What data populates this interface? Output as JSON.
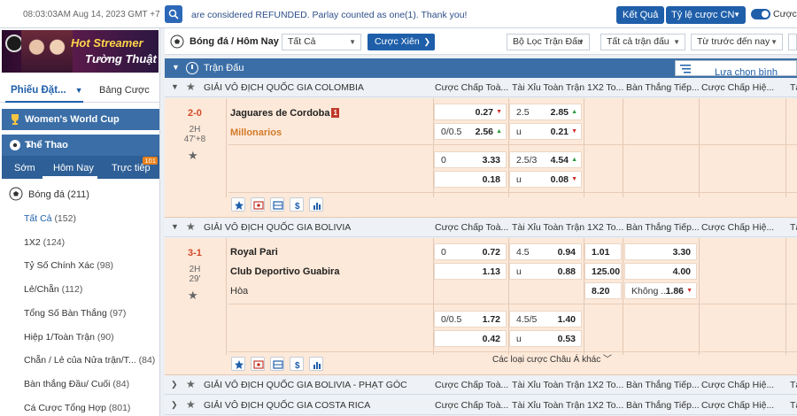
{
  "topbar": {
    "clock": "08:03:03AM Aug 14, 2023 GMT +7",
    "marquee": "are considered REFUNDED. Parlay counted as one(1). Thank you!",
    "results": "Kết Quả",
    "odds_type": "Tỷ lệ cược CN",
    "toggle_label": "Cược"
  },
  "sidebar": {
    "banner_line1": "Hot Streamer",
    "banner_line2": "Tường Thuật",
    "tab_bets": "Phiếu Đặt...",
    "tab_parlay": "Bảng Cược",
    "womens_world_cup": "Women's World Cup",
    "sports": "Thể Thao",
    "subtabs": [
      "Sớm",
      "Hôm Nay",
      "Trực tiếp"
    ],
    "live_count": "101",
    "soccer": "Bóng đá (211)",
    "markets": [
      {
        "label": "Tất Cả",
        "count": "(152)",
        "active": true
      },
      {
        "label": "1X2",
        "count": "(124)"
      },
      {
        "label": "Tỷ Số Chính Xác",
        "count": "(98)"
      },
      {
        "label": "Lẻ/Chẵn",
        "count": "(112)"
      },
      {
        "label": "Tổng Số Bàn Thắng",
        "count": "(97)"
      },
      {
        "label": "Hiệp 1/Toàn Trận",
        "count": "(90)"
      },
      {
        "label": "Chẵn / Lẻ của Nửa trận/T...",
        "count": "(84)"
      },
      {
        "label": "Bàn thắng Đầu/ Cuối",
        "count": "(84)"
      },
      {
        "label": "Cá Cược Tổng Hợp",
        "count": "(801)"
      }
    ]
  },
  "filterbar": {
    "title": "Bóng đá / Hôm Nay",
    "all": "Tất Cả",
    "parlay": "Cược Xiên",
    "filter": "Bộ Lọc Trận Đấu",
    "all_matches": "Tất cả trận đấu",
    "sort": "Từ trước đến nay"
  },
  "section": {
    "title": "Trận Đấu",
    "select_match": "Lựa chọn bình thường"
  },
  "columns": [
    "Cược Chấp Toà...",
    "Tài Xỉu Toàn Trận",
    "1X2 To...",
    "Bàn Thắng Tiếp...",
    "Cược Chấp Hiệ...",
    "Tài"
  ],
  "leagues": [
    {
      "name": "GIẢI VÔ ĐỊCH QUỐC GIA COLOMBIA"
    },
    {
      "name": "GIẢI VÔ ĐỊCH QUỐC GIA BOLIVIA"
    },
    {
      "name": "GIẢI VÔ ĐỊCH QUỐC GIA BOLIVIA - PHẠT GÓC"
    },
    {
      "name": "GIẢI VÔ ĐỊCH QUỐC GIA COSTA RICA"
    }
  ],
  "match1": {
    "score": "2-0",
    "half": "2H",
    "minute": "47'+8",
    "home": "Jaguares de Cordoba",
    "home_red": "1",
    "away": "Millonarios",
    "l1": {
      "hdp_h": "",
      "hdp_o": "0.27",
      "ou_h": "2.5",
      "ou_o": "2.85"
    },
    "l2": {
      "hdp_h": "0/0.5",
      "hdp_o": "2.56",
      "ou_h": "u",
      "ou_o": "0.21"
    },
    "l3": {
      "hdp_h": "0",
      "hdp_o": "3.33",
      "ou_h": "2.5/3",
      "ou_o": "4.54"
    },
    "l4": {
      "hdp_h": "",
      "hdp_o": "0.18",
      "ou_h": "u",
      "ou_o": "0.08"
    }
  },
  "match2": {
    "score": "3-1",
    "half": "2H",
    "minute": "29'",
    "home": "Royal Pari",
    "away": "Club Deportivo Guabira",
    "draw": "Hòa",
    "l1": {
      "hdp_h": "0",
      "hdp_o": "0.72",
      "ou_h": "4.5",
      "ou_o": "0.94",
      "x12": "1.01",
      "next": "3.30"
    },
    "l2": {
      "hdp_h": "",
      "hdp_o": "1.13",
      "ou_h": "u",
      "ou_o": "0.88",
      "x12": "125.00",
      "next": "4.00"
    },
    "l3": {
      "x12": "8.20",
      "next_h": "Không ...",
      "next": "1.86"
    },
    "l4": {
      "hdp_h": "0/0.5",
      "hdp_o": "1.72",
      "ou_h": "4.5/5",
      "ou_o": "1.40"
    },
    "l5": {
      "hdp_h": "",
      "hdp_o": "0.42",
      "ou_h": "u",
      "ou_o": "0.53"
    },
    "more": "Các loại cược Châu Á khác"
  },
  "colors": {
    "primary": "#1f5faa",
    "header": "#3b6ea6",
    "row_bg": "#fde9d9",
    "up": "#2a9a3a",
    "down": "#d0302a"
  }
}
